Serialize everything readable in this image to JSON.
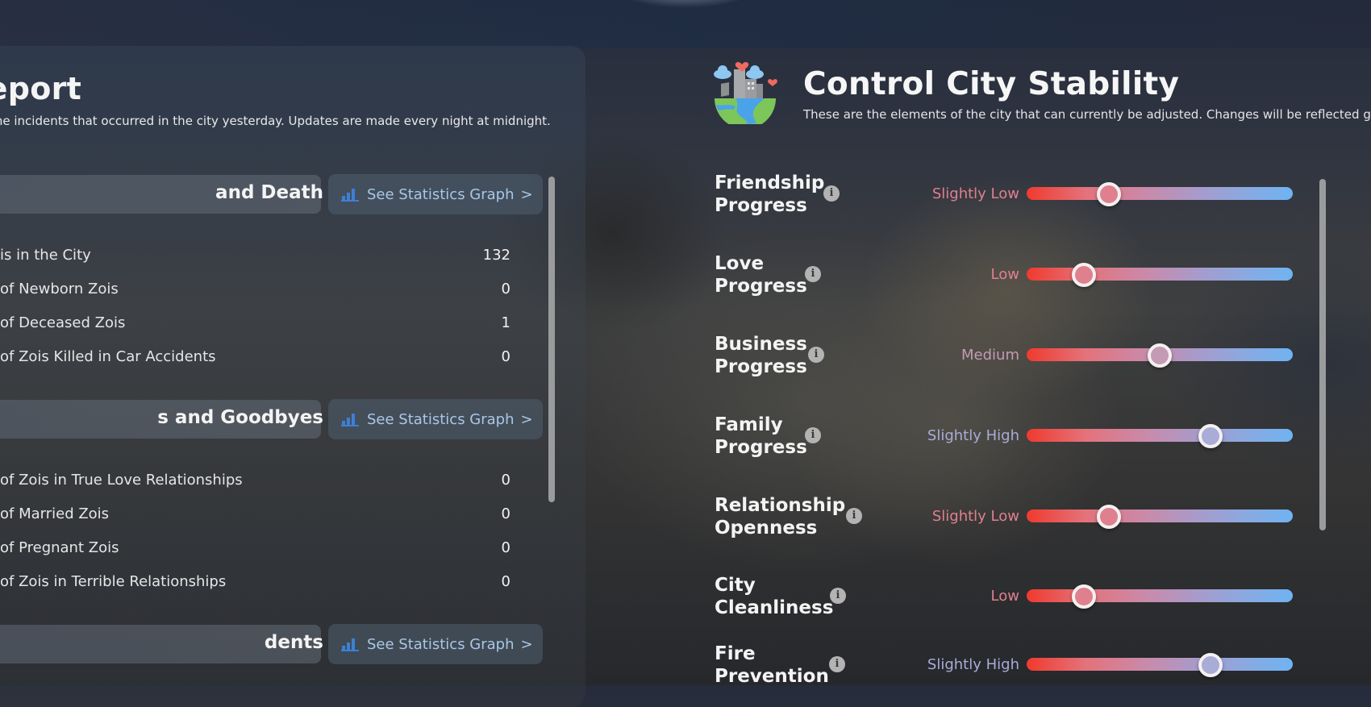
{
  "report": {
    "title": "ty Report",
    "subtitle": "the incidents that occurred in the city yesterday. Updates are made every night at midnight.",
    "sections": [
      {
        "heading": "and Death",
        "button_label": "See Statistics Graph",
        "rows": [
          {
            "label": "is in the City",
            "value": "132"
          },
          {
            "label": "of Newborn Zois",
            "value": "0"
          },
          {
            "label": "of Deceased Zois",
            "value": "1"
          },
          {
            "label": "of Zois Killed in Car Accidents",
            "value": "0"
          }
        ]
      },
      {
        "heading": "s and Goodbyes",
        "button_label": "See Statistics Graph",
        "rows": [
          {
            "label": "of Zois in True Love Relationships",
            "value": "0"
          },
          {
            "label": "of Married Zois",
            "value": "0"
          },
          {
            "label": "of Pregnant Zois",
            "value": "0"
          },
          {
            "label": "of Zois in Terrible Relationships",
            "value": "0"
          }
        ]
      },
      {
        "heading": "dents",
        "button_label": "See Statistics Graph",
        "rows": []
      }
    ],
    "chevron": ">",
    "button_icon": "bar-chart-icon"
  },
  "control": {
    "title": "Control City Stability",
    "subtitle": "These are the elements of the city that can currently be adjusted. Changes will be reflected gra",
    "icon": "city-globe-icon",
    "info_glyph": "i",
    "colors": {
      "low": "#e0808e",
      "medium": "#c59ab4",
      "high": "#a9acd6",
      "slider_start": "#f03a2e",
      "slider_end": "#6fb3f2"
    },
    "sliders": [
      {
        "name_line1": "Friendship",
        "name_line2": "Progress",
        "level": "Slightly Low",
        "value": 0.31
      },
      {
        "name_line1": "Love",
        "name_line2": "Progress",
        "level": "Low",
        "value": 0.215
      },
      {
        "name_line1": "Business",
        "name_line2": "Progress",
        "level": "Medium",
        "value": 0.5
      },
      {
        "name_line1": "Family",
        "name_line2": "Progress",
        "level": "Slightly High",
        "value": 0.69
      },
      {
        "name_line1": "Relationship",
        "name_line2": "Openness",
        "level": "Slightly Low",
        "value": 0.31
      },
      {
        "name_line1": "City",
        "name_line2": "Cleanliness",
        "level": "Low",
        "value": 0.215
      },
      {
        "name_line1": "Fire",
        "name_line2": "Prevention",
        "level": "Slightly High",
        "value": 0.69
      }
    ]
  }
}
